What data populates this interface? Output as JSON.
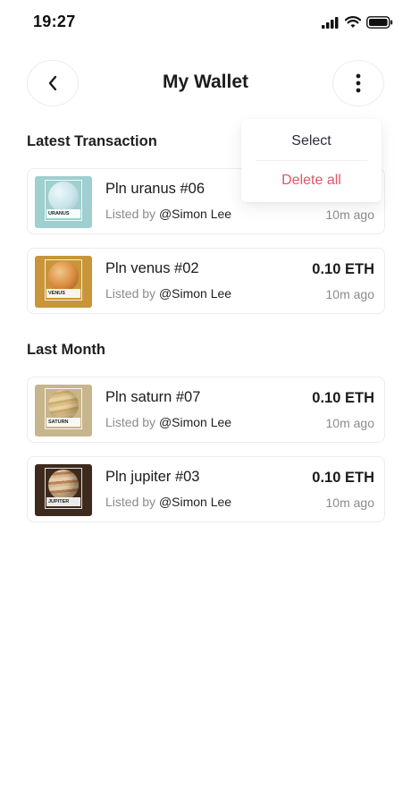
{
  "status_bar": {
    "time": "19:27"
  },
  "header": {
    "title": "My Wallet",
    "back_icon": "chevron-left-icon",
    "more_icon": "more-vertical-icon"
  },
  "menu": {
    "items": [
      "Select",
      "Delete all"
    ],
    "delete_color": "#e0566a"
  },
  "sections": [
    {
      "title": "Latest Transaction",
      "items": [
        {
          "name": "Pln uranus #06",
          "listed_prefix": "Listed by",
          "user": "@Simon Lee",
          "price": "",
          "time": "10m ago",
          "thumb_label": "URANUS",
          "thumb_bg": "#9fcfcf",
          "planet_color": "#c8e4ea"
        },
        {
          "name": "Pln venus #02",
          "listed_prefix": "Listed by",
          "user": "@Simon Lee",
          "price": "0.10 ETH",
          "time": "10m ago",
          "thumb_label": "VENUS",
          "thumb_bg": "#c99538",
          "planet_color": "#d88a3c"
        }
      ]
    },
    {
      "title": "Last Month",
      "items": [
        {
          "name": "Pln saturn #07",
          "listed_prefix": "Listed by",
          "user": "@Simon Lee",
          "price": "0.10 ETH",
          "time": "10m ago",
          "thumb_label": "SATURN",
          "thumb_bg": "#c7b58c",
          "planet_color": "#d6b878"
        },
        {
          "name": "Pln jupiter #03",
          "listed_prefix": "Listed by",
          "user": "@Simon Lee",
          "price": "0.10 ETH",
          "time": "10m ago",
          "thumb_label": "JUPITER",
          "thumb_bg": "#3d2a1d",
          "planet_color": "#caa37c"
        }
      ]
    }
  ]
}
